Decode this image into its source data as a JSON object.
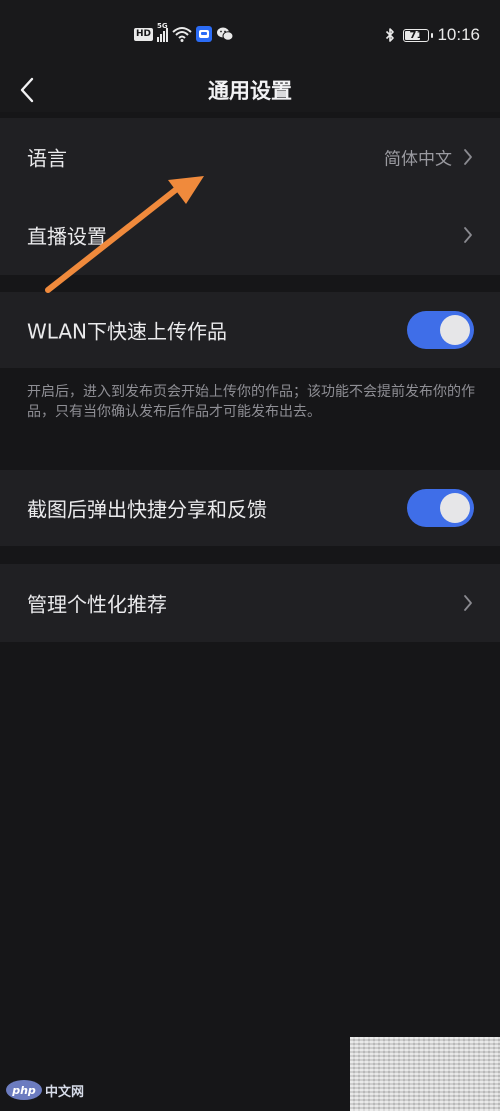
{
  "status_bar": {
    "hd_badge": "HD",
    "network_label": "5G",
    "time": "10:16",
    "battery_level": "71",
    "battery_fraction": 0.71,
    "icons": [
      "signal-icon",
      "wifi-icon",
      "app-notification-icon",
      "wechat-icon",
      "bluetooth-icon",
      "battery-icon"
    ]
  },
  "header": {
    "title": "通用设置",
    "back_icon": "chevron-left-icon"
  },
  "settings": {
    "language": {
      "label": "语言",
      "value": "简体中文"
    },
    "live": {
      "label": "直播设置"
    },
    "wlan_upload": {
      "label": "WLAN下快速上传作品",
      "enabled": true,
      "hint": "开启后，进入到发布页会开始上传你的作品；该功能不会提前发布你的作品，只有当你确认发布后作品才可能发布出去。"
    },
    "screenshot_share": {
      "label": "截图后弹出快捷分享和反馈",
      "enabled": true
    },
    "personalization": {
      "label": "管理个性化推荐"
    }
  },
  "colors": {
    "background": "#161618",
    "section": "#202023",
    "toggle_on": "#3f6ee8",
    "annotation_arrow": "#f08a3c"
  },
  "watermark": {
    "logo": "php",
    "text": "中文网"
  }
}
